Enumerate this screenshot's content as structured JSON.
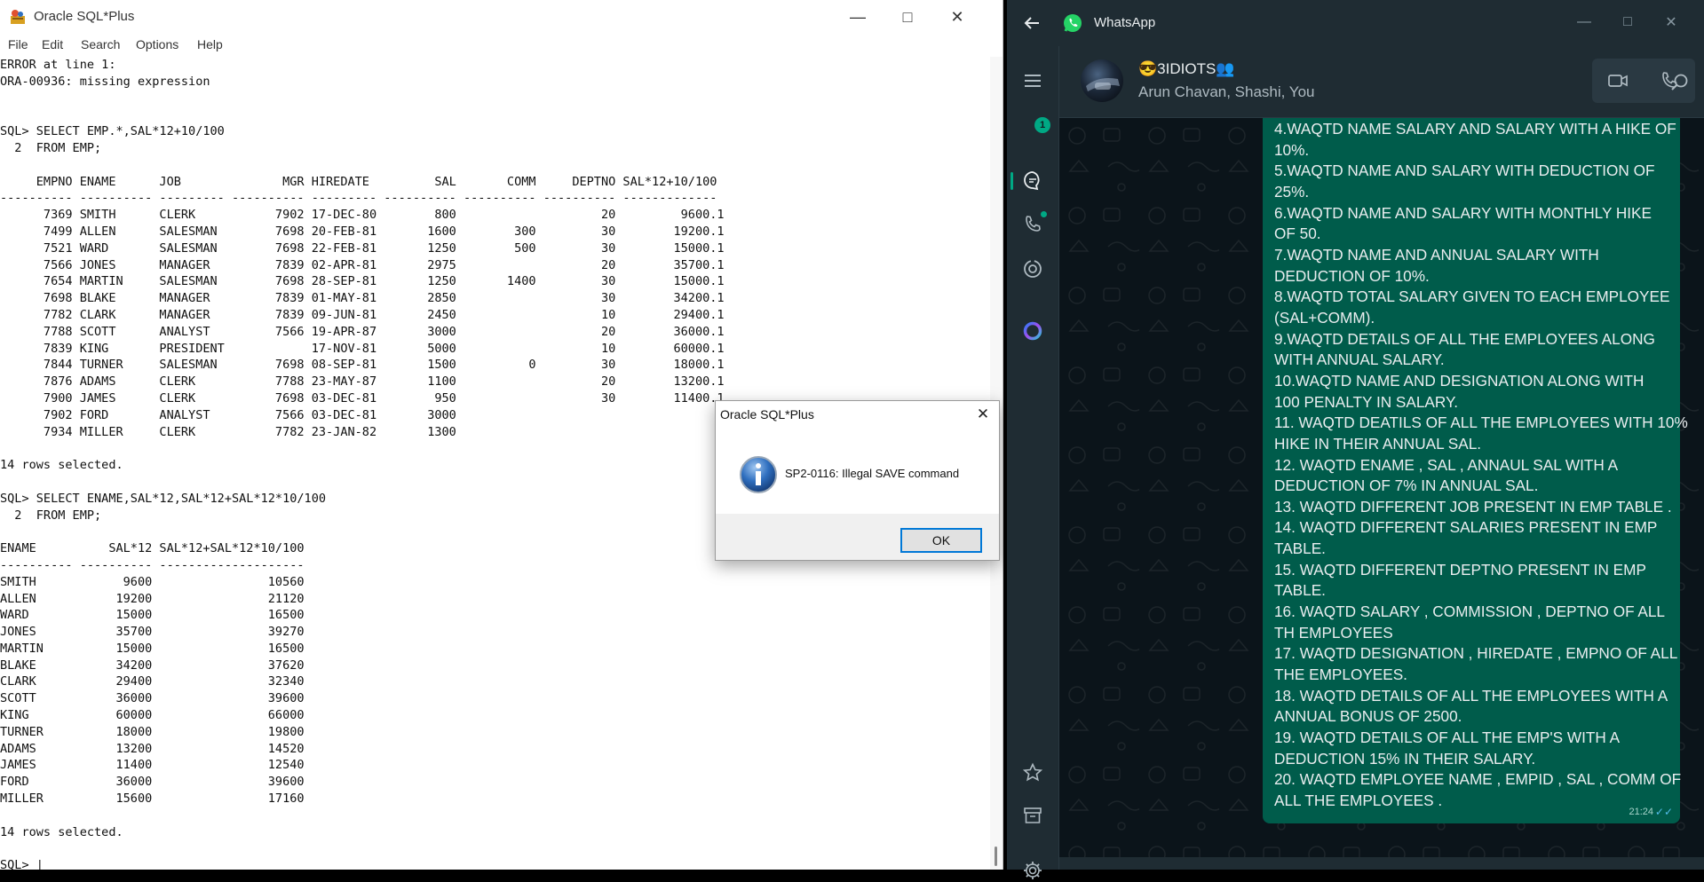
{
  "sqlplus": {
    "title": "Oracle SQL*Plus",
    "menu": [
      "File",
      "Edit",
      "Search",
      "Options",
      "Help"
    ],
    "console_lines": [
      "ERROR at line 1:",
      "ORA-00936: missing expression",
      "",
      "",
      "SQL> SELECT EMP.*,SAL*12+10/100",
      "  2  FROM EMP;",
      "",
      "     EMPNO ENAME      JOB              MGR HIREDATE         SAL       COMM     DEPTNO SAL*12+10/100",
      "---------- ---------- --------- ---------- --------- ---------- ---------- ---------- -------------",
      "      7369 SMITH      CLERK           7902 17-DEC-80        800                    20         9600.1",
      "      7499 ALLEN      SALESMAN        7698 20-FEB-81       1600        300         30        19200.1",
      "      7521 WARD       SALESMAN        7698 22-FEB-81       1250        500         30        15000.1",
      "      7566 JONES      MANAGER         7839 02-APR-81       2975                    20        35700.1",
      "      7654 MARTIN     SALESMAN        7698 28-SEP-81       1250       1400         30        15000.1",
      "      7698 BLAKE      MANAGER         7839 01-MAY-81       2850                    30        34200.1",
      "      7782 CLARK      MANAGER         7839 09-JUN-81       2450                    10        29400.1",
      "      7788 SCOTT      ANALYST         7566 19-APR-87       3000                    20        36000.1",
      "      7839 KING       PRESIDENT            17-NOV-81       5000                    10        60000.1",
      "      7844 TURNER     SALESMAN        7698 08-SEP-81       1500          0         30        18000.1",
      "      7876 ADAMS      CLERK           7788 23-MAY-87       1100                    20        13200.1",
      "      7900 JAMES      CLERK           7698 03-DEC-81        950                    30        11400.1",
      "      7902 FORD       ANALYST         7566 03-DEC-81       3000",
      "      7934 MILLER     CLERK           7782 23-JAN-82       1300",
      "",
      "14 rows selected.",
      "",
      "SQL> SELECT ENAME,SAL*12,SAL*12+SAL*12*10/100",
      "  2  FROM EMP;",
      "",
      "ENAME          SAL*12 SAL*12+SAL*12*10/100",
      "---------- ---------- --------------------",
      "SMITH            9600                10560",
      "ALLEN           19200                21120",
      "WARD            15000                16500",
      "JONES           35700                39270",
      "MARTIN          15000                16500",
      "BLAKE           34200                37620",
      "CLARK           29400                32340",
      "SCOTT           36000                39600",
      "KING            60000                66000",
      "TURNER          18000                19800",
      "ADAMS           13200                14520",
      "JAMES           11400                12540",
      "FORD            36000                39600",
      "MILLER          15600                17160",
      "",
      "14 rows selected.",
      "",
      "SQL> |"
    ]
  },
  "dialog": {
    "title": "Oracle SQL*Plus",
    "message": "SP2-0116: Illegal SAVE command",
    "ok_label": "OK"
  },
  "whatsapp": {
    "app_title": "WhatsApp",
    "chat_name": "😎3IDIOTS👥",
    "members": "Arun Chavan, Shashi, You",
    "unread_badge": "1",
    "message_lines": [
      "4.WAQTD NAME SALARY AND SALARY WITH A HIKE OF",
      "10%.",
      "5.WAQTD NAME AND SALARY WITH DEDUCTION OF",
      "25%.",
      "6.WAQTD NAME AND SALARY WITH  MONTHLY HIKE",
      "OF 50.",
      "7.WAQTD NAME AND ANNUAL SALARY WITH",
      "DEDUCTION OF 10%.",
      "8.WAQTD TOTAL SALARY GIVEN TO EACH EMPLOYEE",
      "(SAL+COMM).",
      "9.WAQTD DETAILS OF ALL THE EMPLOYEES ALONG",
      "WITH ANNUAL SALARY.",
      "10.WAQTD NAME AND DESIGNATION ALONG WITH",
      "100 PENALTY IN SALARY.",
      "11. WAQTD DEATILS OF ALL THE EMPLOYEES WITH 10%",
      "HIKE IN THEIR ANNUAL SAL.",
      "12. WAQTD ENAME , SAL , ANNAUL SAL WITH  A",
      "DEDUCTION OF 7% IN ANNUAL SAL.",
      "13. WAQTD DIFFERENT JOB PRESENT IN EMP TABLE .",
      "14. WAQTD DIFFERENT SALARIES PRESENT IN EMP",
      "TABLE.",
      "15. WAQTD DIFFERENT DEPTNO PRESENT IN EMP",
      "TABLE.",
      "16. WAQTD SALARY , COMMISSION , DEPTNO OF ALL",
      "TH EMPLOYEES",
      "17. WAQTD DESIGNATION , HIREDATE , EMPNO OF ALL",
      "THE  EMPLOYEES.",
      "18. WAQTD DETAILS OF ALL THE EMPLOYEES WITH A",
      "ANNUAL BONUS OF 2500.",
      "19. WAQTD DETAILS OF ALL THE EMP'S WITH A",
      "DEDUCTION 15% IN THEIR SALARY.",
      "20. WAQTD EMPLOYEE NAME , EMPID , SAL , COMM OF",
      "ALL THE  EMPLOYEES ."
    ],
    "message_time": "21:24",
    "colors": {
      "accent": "#00a884",
      "bubble": "#005c4b",
      "background": "#0b141a",
      "panel": "#1f2c33"
    }
  }
}
